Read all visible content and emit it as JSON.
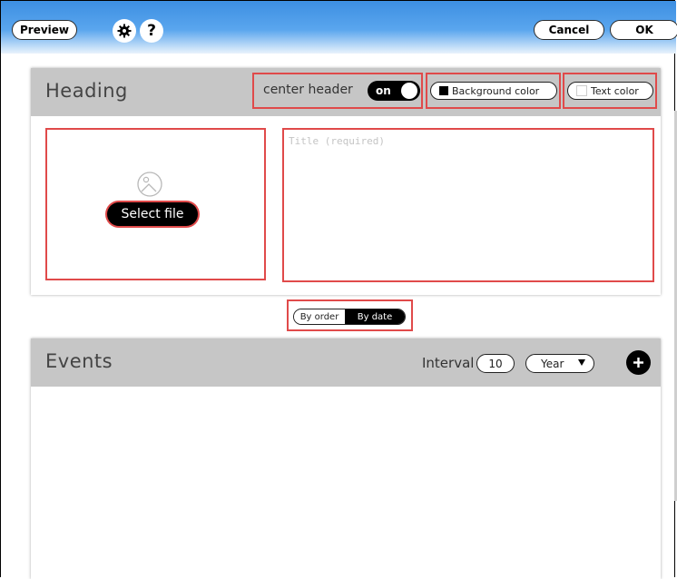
{
  "toolbar": {
    "preview_label": "Preview",
    "settings_icon": "gear-icon",
    "help_icon": "help-icon",
    "help_glyph": "?",
    "cancel_label": "Cancel",
    "ok_label": "OK"
  },
  "heading": {
    "title": "Heading",
    "center_header_label": "center header",
    "center_header_state": "on",
    "background_color_label": "Background color",
    "background_color_swatch": "#000000",
    "text_color_label": "Text color",
    "text_color_swatch": "#ffffff",
    "select_file_label": "Select file",
    "image_placeholder_icon": "image-icon",
    "title_placeholder": "Title (required)"
  },
  "sort": {
    "options": [
      "By order",
      "By date"
    ],
    "selected": "By date"
  },
  "events": {
    "title": "Events",
    "interval_label": "Interval",
    "interval_value": "10",
    "unit_value": "Year",
    "add_icon": "plus-icon"
  },
  "colors": {
    "toolbar_top": "#3d8fe2",
    "highlight": "#e04a4a",
    "panel_header": "#c6c6c6"
  }
}
